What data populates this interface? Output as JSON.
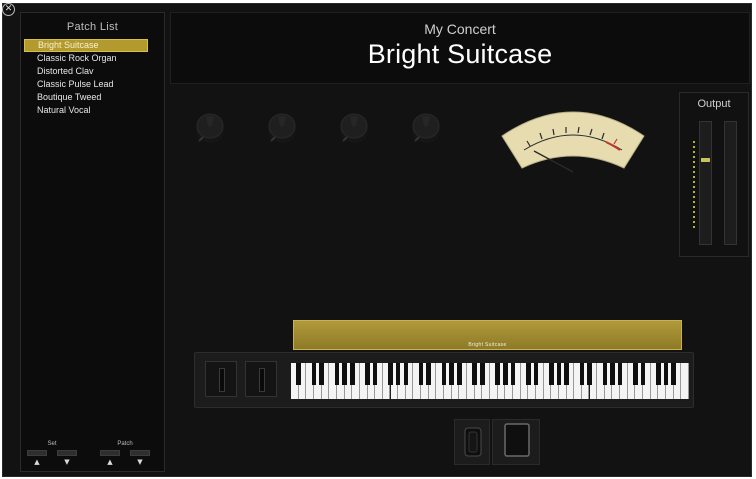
{
  "sidebar": {
    "title": "Patch List",
    "patches": [
      {
        "label": "Bright Suitcase",
        "selected": true
      },
      {
        "label": "Classic Rock Organ",
        "selected": false
      },
      {
        "label": "Distorted Clav",
        "selected": false
      },
      {
        "label": "Classic Pulse Lead",
        "selected": false
      },
      {
        "label": "Boutique Tweed",
        "selected": false
      },
      {
        "label": "Natural Vocal",
        "selected": false
      }
    ],
    "set_label": "Set",
    "patch_label": "Patch",
    "arrow_up": "▲",
    "arrow_down": "▼"
  },
  "header": {
    "concert_name": "My Concert",
    "patch_name": "Bright Suitcase"
  },
  "output": {
    "title": "Output"
  },
  "instrument": {
    "name": "Bright Suitcase"
  },
  "icons": {
    "close": "close-icon",
    "knob": "knob-icon",
    "vu_meter": "vu-meter",
    "output_meter": "level-meter"
  },
  "colors": {
    "selection": "#b39a2e",
    "instrument_bar": "#a08a33",
    "vu_face": "#e6dcb0"
  }
}
